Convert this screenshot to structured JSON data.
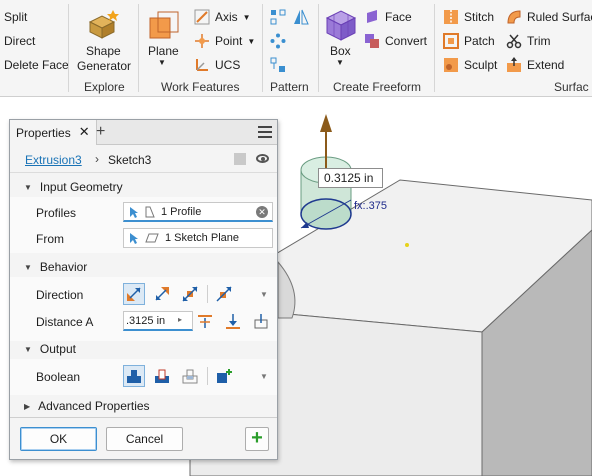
{
  "ribbon": {
    "modify_items": [
      "Split",
      "Direct",
      "Delete Face"
    ],
    "shape_generator": "Shape\nGenerator",
    "shape_generator_l1": "Shape",
    "shape_generator_l2": "Generator",
    "explore_label": "Explore",
    "plane_label": "Plane",
    "axis_label": "Axis",
    "point_label": "Point",
    "ucs_label": "UCS",
    "work_features_label": "Work Features",
    "pattern_label": "Pattern",
    "box_label": "Box",
    "face_label": "Face",
    "convert_label": "Convert",
    "create_freeform_label": "Create Freeform",
    "stitch_label": "Stitch",
    "patch_label": "Patch",
    "sculpt_label": "Sculpt",
    "ruled_surface_label": "Ruled Surfac",
    "trim_label": "Trim",
    "extend_label": "Extend",
    "surface_label": "Surfac"
  },
  "panel": {
    "tab_label": "Properties",
    "crumb_parent": "Extrusion3",
    "crumb_current": "Sketch3",
    "sections": {
      "input_geometry": "Input Geometry",
      "behavior": "Behavior",
      "output": "Output",
      "advanced": "Advanced Properties"
    },
    "profiles_label": "Profiles",
    "profiles_value": "1 Profile",
    "from_label": "From",
    "from_value": "1 Sketch Plane",
    "direction_label": "Direction",
    "distance_label": "Distance A",
    "distance_value": ".3125 in",
    "boolean_label": "Boolean",
    "ok_label": "OK",
    "cancel_label": "Cancel"
  },
  "viewport": {
    "dimension_value": "0.3125 in",
    "fx_label": "fx:.375"
  },
  "colors": {
    "accent": "#3c8fd0",
    "link": "#1a73b6",
    "add_green": "#2a9d2a",
    "arrow_brown": "#8b5a1a",
    "cylinder_fill": "#cfe6d8"
  }
}
